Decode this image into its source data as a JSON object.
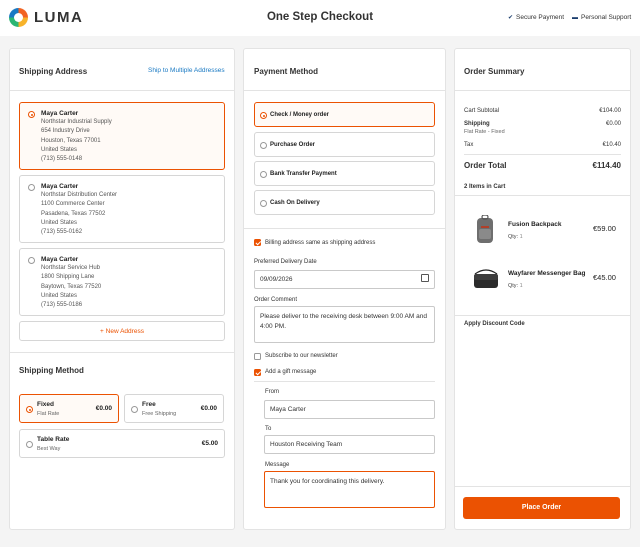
{
  "header": {
    "brand": "LUMA",
    "title": "One Step Checkout",
    "secure_payment": "Secure Payment",
    "personal_support": "Personal Support"
  },
  "shipping_address": {
    "title": "Shipping Address",
    "ship_multiple": "Ship to Multiple Addresses",
    "addresses": [
      {
        "name": "Maya Carter",
        "company": "Northstar Industrial Supply",
        "street": "654 Industry Drive",
        "city": "Houston, Texas 77001",
        "country": "United States",
        "phone": "(713) 555-0148",
        "selected": true
      },
      {
        "name": "Maya Carter",
        "company": "Northstar Distribution Center",
        "street": "1100 Commerce Center",
        "city": "Pasadena, Texas 77502",
        "country": "United States",
        "phone": "(713) 555-0162",
        "selected": false
      },
      {
        "name": "Maya Carter",
        "company": "Northstar Service Hub",
        "street": "1800 Shipping Lane",
        "city": "Baytown, Texas 77520",
        "country": "United States",
        "phone": "(713) 555-0186",
        "selected": false
      }
    ],
    "new_address": "+ New Address"
  },
  "shipping_method": {
    "title": "Shipping Method",
    "options": [
      {
        "name": "Fixed",
        "sub": "Flat Rate",
        "price": "€0.00",
        "selected": true
      },
      {
        "name": "Free",
        "sub": "Free Shipping",
        "price": "€0.00",
        "selected": false
      },
      {
        "name": "Table Rate",
        "sub": "Best Way",
        "price": "€5.00",
        "selected": false
      }
    ]
  },
  "payment": {
    "title": "Payment Method",
    "options": [
      {
        "label": "Check / Money order",
        "selected": true
      },
      {
        "label": "Purchase Order",
        "selected": false
      },
      {
        "label": "Bank Transfer Payment",
        "selected": false
      },
      {
        "label": "Cash On Delivery",
        "selected": false
      }
    ],
    "billing_same": "Billing address same as shipping address",
    "delivery_date_label": "Preferred Delivery Date",
    "delivery_date_value": "09/09/2026",
    "comment_label": "Order Comment",
    "comment_value": "Please deliver to the receiving desk between 9:00 AM and 4:00 PM.",
    "newsletter": "Subscribe to our newsletter",
    "gift": "Add a gift message",
    "from_label": "From",
    "from_value": "Maya Carter",
    "to_label": "To",
    "to_value": "Houston Receiving Team",
    "message_label": "Message",
    "message_value": "Thank you for coordinating this delivery."
  },
  "summary": {
    "title": "Order Summary",
    "subtotal_label": "Cart Subtotal",
    "subtotal_value": "€104.00",
    "shipping_label": "Shipping",
    "shipping_sub": "Flat Rate - Fixed",
    "shipping_value": "€0.00",
    "tax_label": "Tax",
    "tax_value": "€10.40",
    "total_label": "Order Total",
    "total_value": "€114.40",
    "items_in_cart": "2 Items in Cart",
    "items": [
      {
        "name": "Fusion Backpack",
        "qty_label": "Qty:",
        "qty": "1",
        "price": "€59.00"
      },
      {
        "name": "Wayfarer Messenger Bag",
        "qty_label": "Qty:",
        "qty": "1",
        "price": "€45.00"
      }
    ],
    "discount": "Apply Discount Code",
    "place_order": "Place Order"
  },
  "colors": {
    "accent": "#eb5202",
    "link": "#1979c3"
  }
}
